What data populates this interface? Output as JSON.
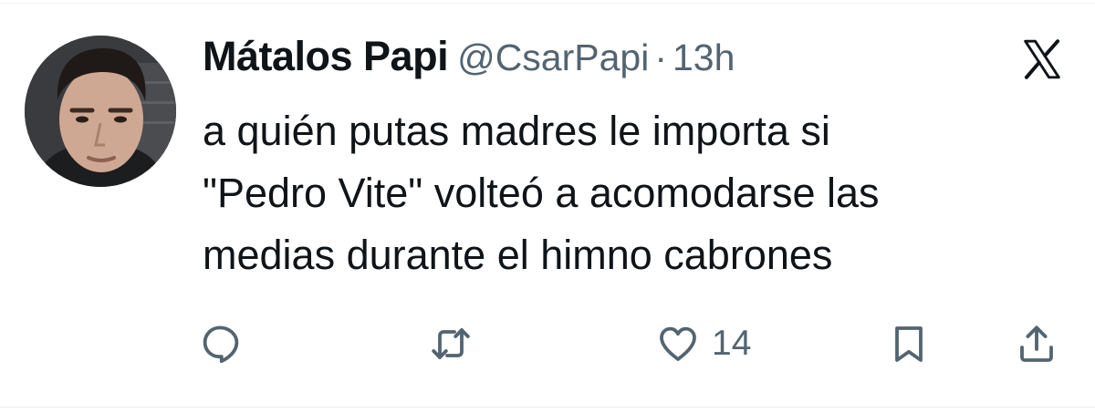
{
  "tweet": {
    "author": {
      "display_name": "Mátalos Papi",
      "handle": "@CsarPapi",
      "separator": "·",
      "time": "13h"
    },
    "platform_icon": "x-logo-icon",
    "text_lines": [
      "a quién putas madres le importa si",
      "\"Pedro Vite\" volteó a acomodarse las",
      "medias durante el himno cabrones"
    ],
    "actions": {
      "reply_icon": "reply-icon",
      "retweet_icon": "retweet-icon",
      "like_icon": "heart-icon",
      "like_count": "14",
      "bookmark_icon": "bookmark-icon",
      "share_icon": "share-icon"
    },
    "colors": {
      "text": "#0f1419",
      "secondary": "#536471",
      "background": "#ffffff"
    }
  }
}
